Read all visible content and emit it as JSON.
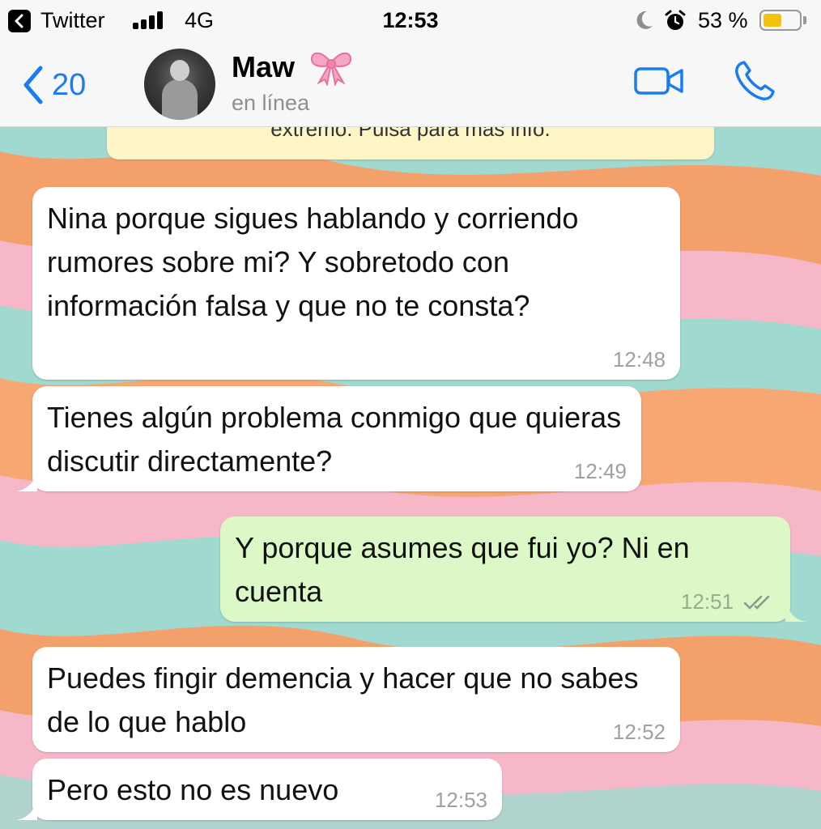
{
  "status_bar": {
    "back_app": "Twitter",
    "network": "4G",
    "time": "12:53",
    "battery_text": "53 %",
    "battery_level": 0.53,
    "signal_bars": 4,
    "icons": [
      "back-arrow-icon",
      "signal-icon",
      "moon-icon",
      "alarm-icon",
      "battery-icon"
    ]
  },
  "header": {
    "back_count": "20",
    "contact_name": "Maw",
    "contact_emoji": "ribbon-bow",
    "status": "en línea",
    "icons": [
      "chevron-left-icon",
      "video-call-icon",
      "phone-icon"
    ],
    "accent_color": "#1a7cf2"
  },
  "notice": {
    "text": "extremo. Pulsa para más info."
  },
  "messages": [
    {
      "direction": "in",
      "text": "Nina porque sigues hablando y corriendo rumores sobre mi? Y sobretodo con información falsa y que no te consta?",
      "time": "12:48"
    },
    {
      "direction": "in",
      "text": "Tienes algún problema conmigo que quieras discutir directamente?",
      "time": "12:49"
    },
    {
      "direction": "out",
      "text": "Y porque asumes que fui yo? Ni en cuenta",
      "time": "12:51",
      "read": true
    },
    {
      "direction": "in",
      "text": "Puedes fingir demencia y hacer que no sabes de lo que hablo",
      "time": "12:52"
    },
    {
      "direction": "in",
      "text": "Pero esto no es nuevo",
      "time": "12:53"
    }
  ],
  "colors": {
    "incoming_bubble": "#ffffff",
    "outgoing_bubble": "#dcf8c6",
    "notice_bubble": "#fdf5c6",
    "wallpaper": [
      "#f4a06a",
      "#f6b8c8",
      "#9fd9cf",
      "#f7a872"
    ]
  }
}
